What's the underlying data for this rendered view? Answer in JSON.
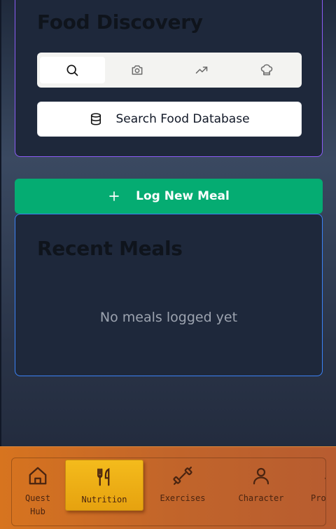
{
  "food_discovery": {
    "title": "Food Discovery",
    "tabs": [
      {
        "icon": "search-icon",
        "active": true
      },
      {
        "icon": "camera-icon",
        "active": false
      },
      {
        "icon": "trending-up-icon",
        "active": false
      },
      {
        "icon": "chef-hat-icon",
        "active": false
      }
    ],
    "search_button": {
      "label": "Search Food Database",
      "icon": "database-icon"
    }
  },
  "log_meal": {
    "label": "Log New Meal",
    "icon": "plus-icon"
  },
  "recent_meals": {
    "title": "Recent Meals",
    "empty_message": "No meals logged yet"
  },
  "bottom_nav": {
    "items": [
      {
        "label_line1": "Quest",
        "label_line2": "Hub",
        "icon": "home-icon",
        "active": false
      },
      {
        "label_line1": "Nutrition",
        "label_line2": "",
        "icon": "utensils-icon",
        "active": true
      },
      {
        "label_line1": "Exercises",
        "label_line2": "",
        "icon": "dumbbell-icon",
        "active": false
      },
      {
        "label_line1": "Character",
        "label_line2": "",
        "icon": "user-icon",
        "active": false
      },
      {
        "label_line1": "Prog",
        "label_line2": "",
        "icon": "chevron-up-icon",
        "active": false
      }
    ]
  },
  "colors": {
    "card_bg": "#1e283b",
    "discovery_border": "#8b5cf6",
    "recent_border": "#3b82f6",
    "log_button": "#05ac72",
    "nav_bg": "#c2652a",
    "nav_active": "#f4bb1c"
  }
}
